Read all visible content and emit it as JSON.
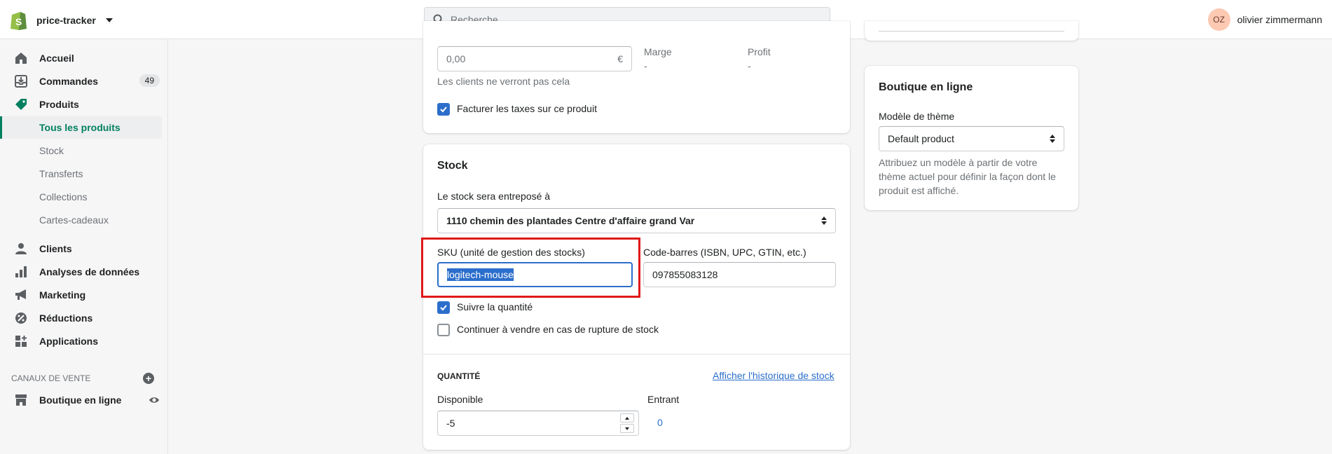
{
  "topbar": {
    "store_name": "price-tracker",
    "search_placeholder": "Recherche",
    "user_initials": "OZ",
    "user_name": "olivier zimmermann"
  },
  "sidebar": {
    "items": [
      {
        "label": "Accueil",
        "icon": "home-icon"
      },
      {
        "label": "Commandes",
        "icon": "orders-icon",
        "badge": "49"
      },
      {
        "label": "Produits",
        "icon": "tag-icon"
      }
    ],
    "product_sub": [
      "Tous les produits",
      "Stock",
      "Transferts",
      "Collections",
      "Cartes-cadeaux"
    ],
    "items2": [
      {
        "label": "Clients",
        "icon": "person-icon"
      },
      {
        "label": "Analyses de données",
        "icon": "bar-chart-icon"
      },
      {
        "label": "Marketing",
        "icon": "megaphone-icon"
      },
      {
        "label": "Réductions",
        "icon": "discount-icon"
      },
      {
        "label": "Applications",
        "icon": "apps-icon"
      }
    ],
    "sales_channels_heading": "CANAUX DE VENTE",
    "online_store": "Boutique en ligne"
  },
  "pricing": {
    "cost_value": "0,00",
    "currency": "€",
    "margin_label": "Marge",
    "margin_value": "-",
    "profit_label": "Profit",
    "profit_value": "-",
    "hint": "Les clients ne verront pas cela",
    "tax_label": "Facturer les taxes sur ce produit"
  },
  "stock": {
    "title": "Stock",
    "location_label": "Le stock sera entreposé à",
    "location_value": "1110 chemin des plantades Centre d'affaire grand Var",
    "sku_label": "SKU (unité de gestion des stocks)",
    "sku_value": "logitech-mouse",
    "barcode_label": "Code-barres (ISBN, UPC, GTIN, etc.)",
    "barcode_value": "097855083128",
    "track_label": "Suivre la quantité",
    "continue_label": "Continuer à vendre en cas de rupture de stock",
    "quantity_heading": "QUANTITÉ",
    "history_link": "Afficher l'historique de stock",
    "available_label": "Disponible",
    "available_value": "-5",
    "incoming_label": "Entrant",
    "incoming_value": "0"
  },
  "online_store_card": {
    "title": "Boutique en ligne",
    "theme_label": "Modèle de thème",
    "theme_value": "Default product",
    "help": "Attribuez un modèle à partir de votre thème actuel pour définir la façon dont le produit est affiché."
  },
  "colors": {
    "accent": "#008060",
    "checkbox": "#2c6ecb",
    "highlight": "#e01818"
  }
}
